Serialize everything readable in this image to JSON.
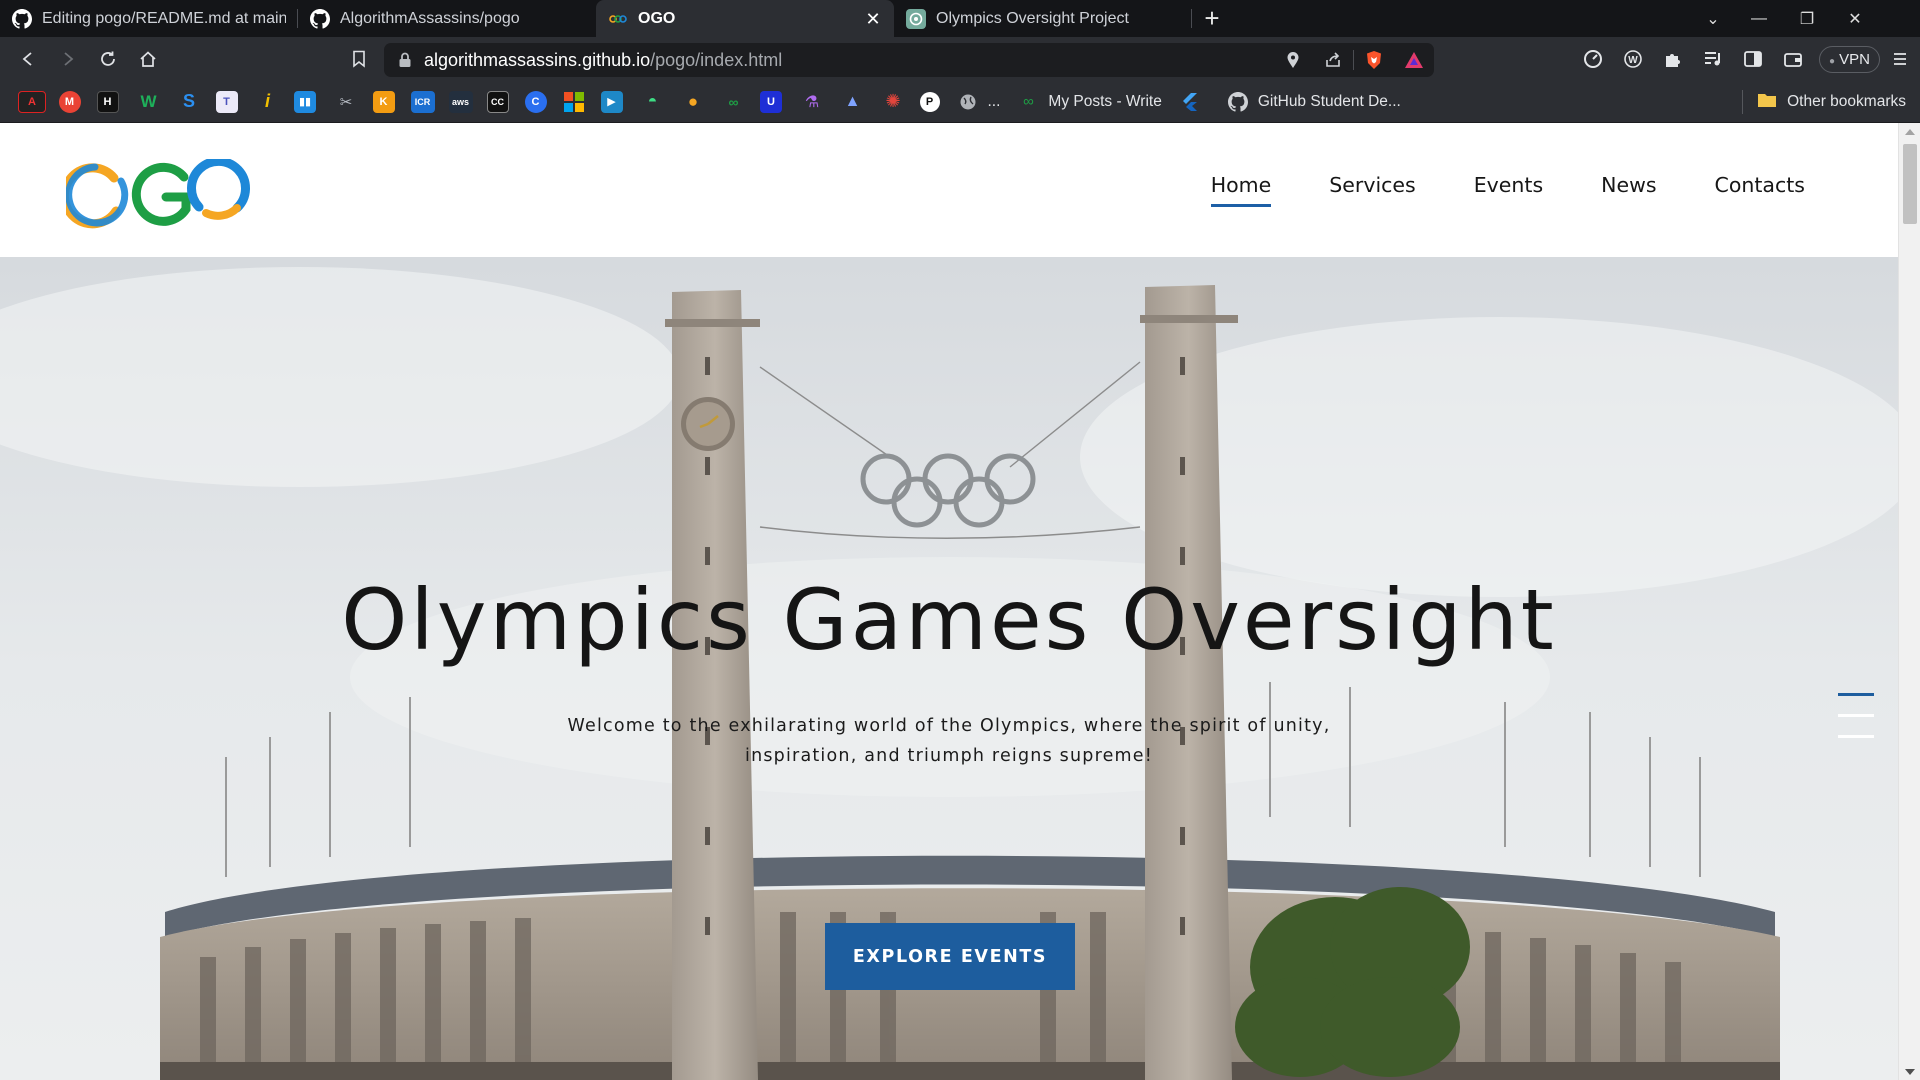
{
  "browser": {
    "tabs": [
      {
        "title": "Editing pogo/README.md at main · Al",
        "icon": "github-icon"
      },
      {
        "title": "AlgorithmAssassins/pogo",
        "icon": "github-icon"
      },
      {
        "title": "OGO",
        "icon": "ogo-rings-icon",
        "active": true
      },
      {
        "title": "Olympics Oversight Project",
        "icon": "chatgpt-icon"
      }
    ],
    "new_tab_label": "+",
    "address": {
      "host": "algorithmassassins.github.io",
      "path": "/pogo/index.html"
    },
    "vpn_label": "VPN",
    "bookmarks_text": [
      {
        "label": "...",
        "icon": "globe-icon"
      },
      {
        "label": "My Posts - Write",
        "icon": "bookmark-icon"
      },
      {
        "label": "",
        "icon": "bookmark-icon"
      },
      {
        "label": "GitHub Student De...",
        "icon": "github-icon"
      }
    ],
    "other_bookmarks_label": "Other bookmarks"
  },
  "site": {
    "logo_alt": "OGO",
    "nav": [
      {
        "label": "Home",
        "active": true
      },
      {
        "label": "Services"
      },
      {
        "label": "Events"
      },
      {
        "label": "News"
      },
      {
        "label": "Contacts"
      }
    ],
    "hero": {
      "title": "Olympics Games Oversight",
      "subtitle_line1": "Welcome to the exhilarating world of the Olympics, where the spirit of unity,",
      "subtitle_line2": "inspiration, and triumph reigns supreme!",
      "cta_label": "EXPLORE EVENTS"
    }
  },
  "colors": {
    "accent": "#1d5d9e",
    "logo_orange": "#f5a623",
    "logo_blue": "#1e88d8",
    "logo_green": "#1e9e45"
  }
}
